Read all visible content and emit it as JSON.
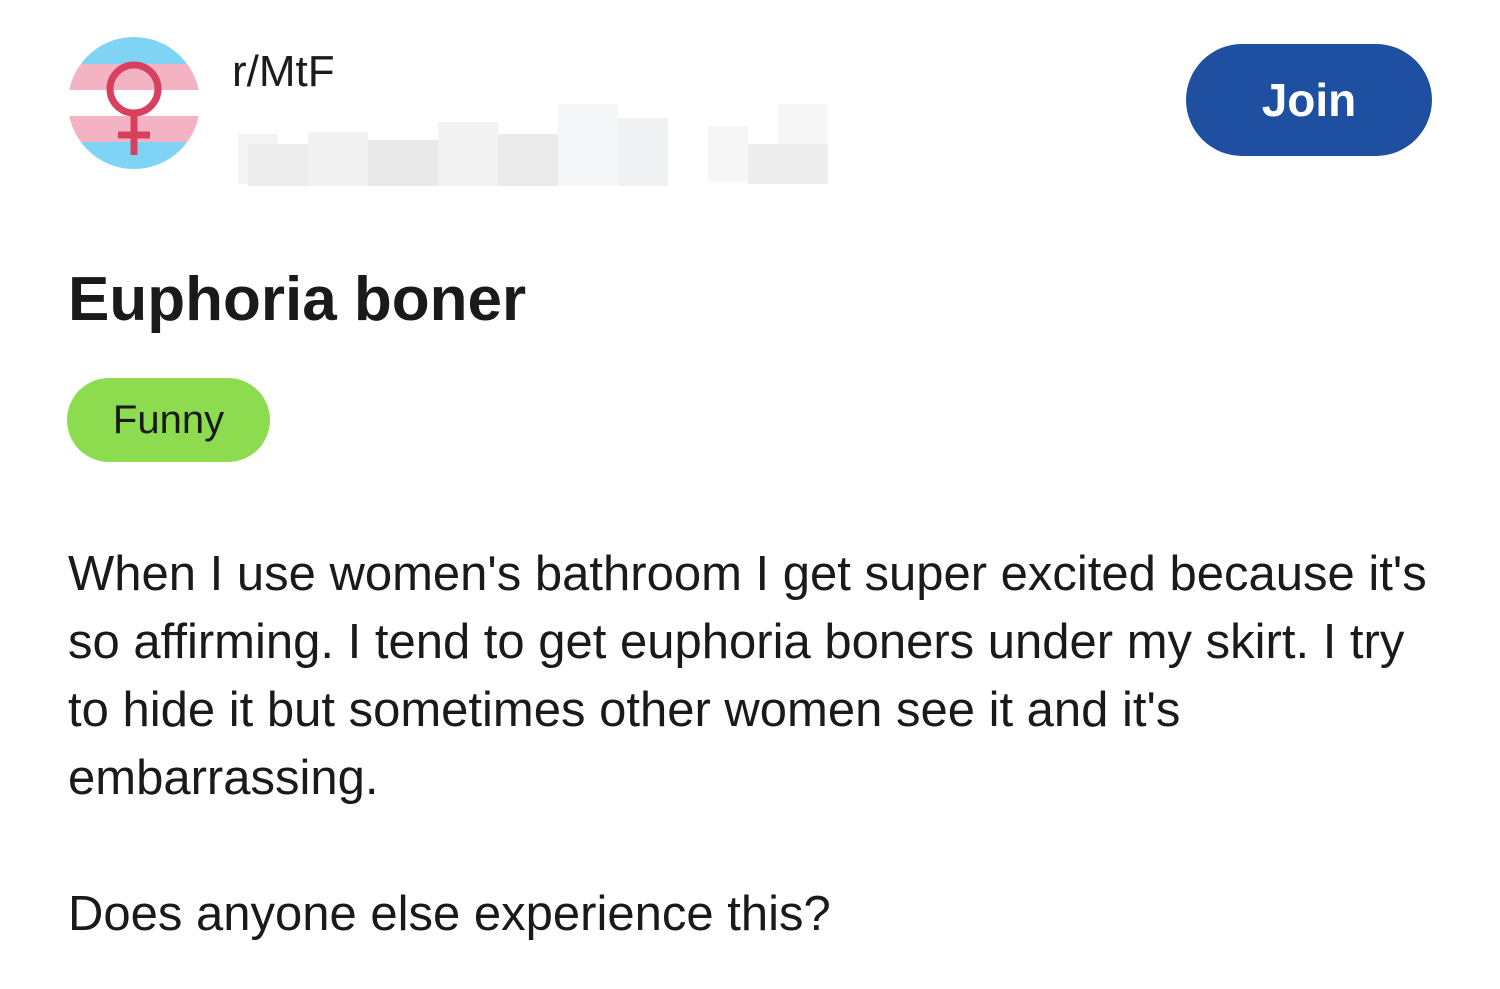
{
  "community": {
    "name": "r/MtF",
    "avatar_icon": "transgender-flag-venus-icon",
    "flag_colors": [
      "#5bcefa",
      "#f5a9b8",
      "#ffffff"
    ],
    "symbol_color": "#d9405e",
    "join_label": "Join",
    "join_color": "#1f4fa0"
  },
  "post": {
    "title": "Euphoria boner",
    "flair": {
      "label": "Funny",
      "color": "#8ddc4f"
    },
    "body": [
      "When I use women's bathroom I get super excited because it's so affirming. I tend to get euphoria boners under my skirt. I try to hide it but sometimes other women see it and it's embarrassing.",
      "Does anyone else experience this?"
    ]
  }
}
